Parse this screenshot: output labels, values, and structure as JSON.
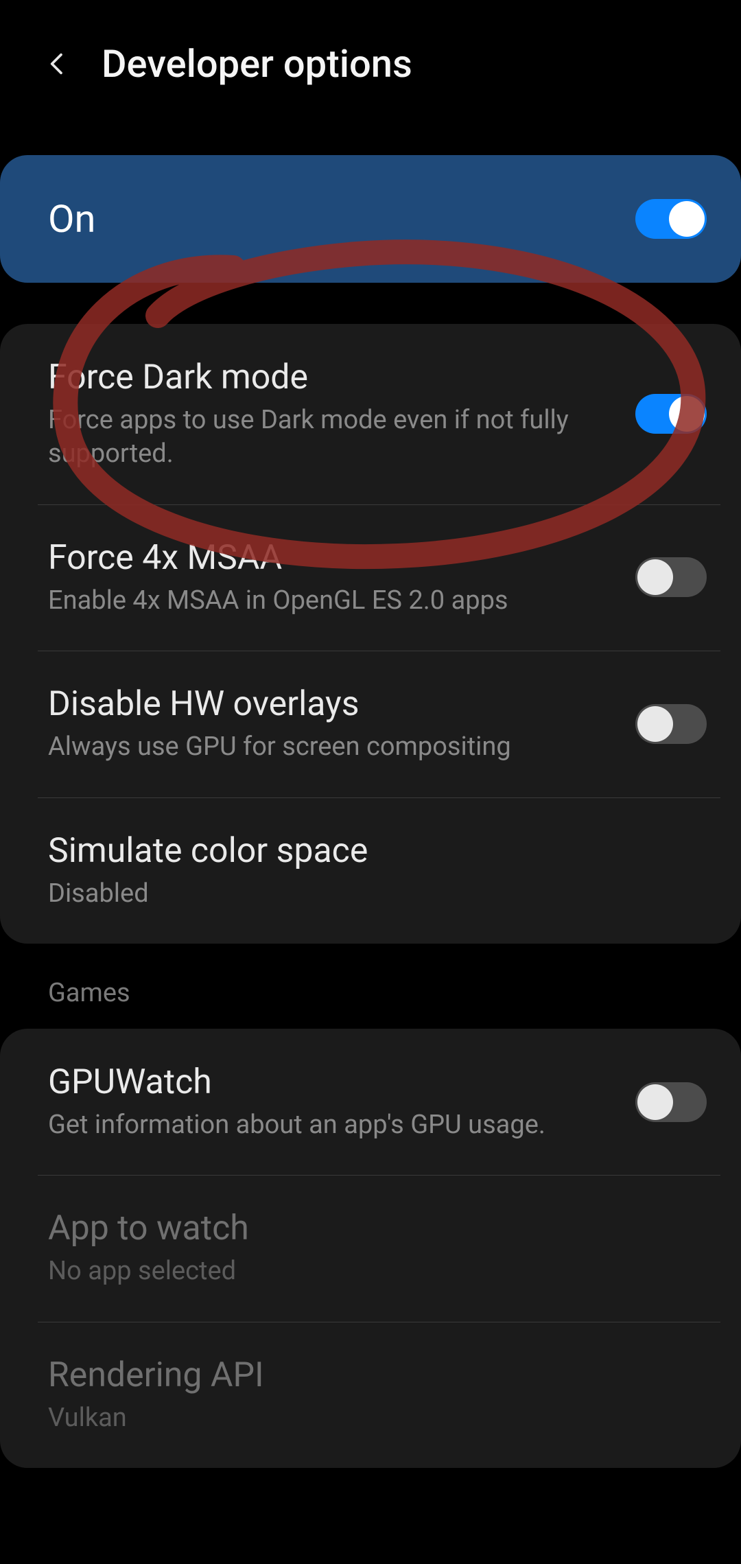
{
  "header": {
    "title": "Developer options"
  },
  "master": {
    "label": "On",
    "state": "on"
  },
  "group1": {
    "items": [
      {
        "title": "Force Dark mode",
        "sub": "Force apps to use Dark mode even if not fully supported.",
        "toggle": "on"
      },
      {
        "title": "Force 4x MSAA",
        "sub": "Enable 4x MSAA in OpenGL ES 2.0 apps",
        "toggle": "off"
      },
      {
        "title": "Disable HW overlays",
        "sub": "Always use GPU for screen compositing",
        "toggle": "off"
      },
      {
        "title": "Simulate color space",
        "sub": "Disabled"
      }
    ]
  },
  "section2_label": "Games",
  "group2": {
    "items": [
      {
        "title": "GPUWatch",
        "sub": "Get information about an app's GPU usage.",
        "toggle": "off"
      },
      {
        "title": "App to watch",
        "sub": "No app selected",
        "disabled": true
      },
      {
        "title": "Rendering API",
        "sub": "Vulkan",
        "disabled": true
      }
    ]
  },
  "colors": {
    "accent": "#0a84ff",
    "card": "#1b1b1b",
    "master_card": "#1f4a7a",
    "annotation": "#8f2a24"
  }
}
